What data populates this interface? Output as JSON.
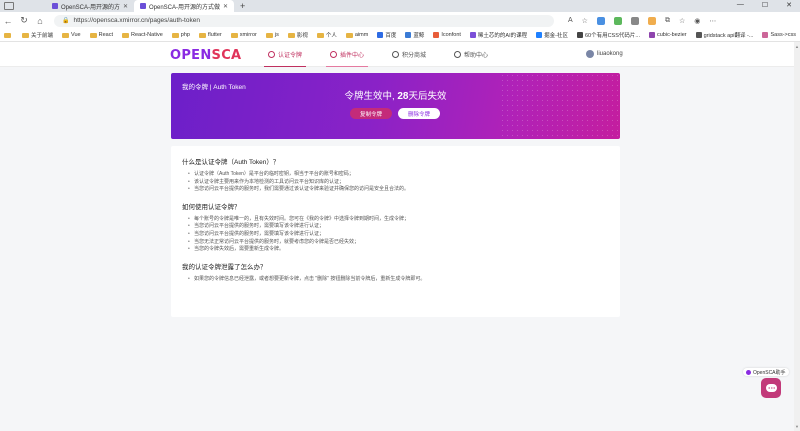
{
  "browser": {
    "tabs": [
      {
        "title": "OpenSCA-用开源的方式做开源风...",
        "active": false
      },
      {
        "title": "OpenSCA-用开源的方式做开源风...",
        "active": true
      }
    ],
    "url": "https://opensca.xmirror.cn/pages/auth-token",
    "bookmarks": [
      "",
      "关于前端",
      "Vue",
      "React",
      "React-Native",
      "php",
      "flutter",
      "xmirror",
      "js",
      "影视",
      "个人",
      "aimm",
      "百度",
      "蓝鲸",
      "Iconfont",
      "稀土芯的的AI的课程",
      "掘金-社区",
      "60个有用CSS代码片...",
      "cubic-bezier",
      "gridstack api翻译 -...",
      "Sass->css"
    ]
  },
  "site": {
    "logo_open": "OPEN",
    "logo_sca": "SCA",
    "nav": [
      {
        "label": "认证令牌",
        "state": "active"
      },
      {
        "label": "插件中心",
        "state": "hover"
      },
      {
        "label": "积分商城",
        "state": "normal"
      },
      {
        "label": "帮助中心",
        "state": "normal"
      }
    ],
    "username": "liuaokong"
  },
  "banner": {
    "label": "我的令牌 | Auth Token",
    "title_prefix": "令牌生效中, ",
    "days": "28",
    "title_suffix": "天后失效",
    "copy_label": "复制令牌",
    "delete_label": "删除令牌"
  },
  "faq": [
    {
      "question": "什么是认证令牌（Auth Token）？",
      "answers": [
        "认证令牌（Auth Token）是平台的临时密钥，相当于平台的账号和密码；",
        "该认证令牌主要用来作为本地检测的工具访问云平台知识库的认证；",
        "当您访问云平台提供的服务时，我们需要通过该认证令牌来验证并确保您的访问是安全且合法的。"
      ]
    },
    {
      "question": "如何使用认证令牌？",
      "answers": [
        "每个账号的令牌是唯一的，且有失效时间。您可在《我的令牌》中选择令牌到期时间，生成令牌；",
        "当您访问云平台提供的服务时，需要填写该令牌进行认证；",
        "当您访问云平台提供的服务时，需要填写该令牌进行认证；",
        "当您无法正常访问云平台提供的服务时，就要考虑您的令牌是否已经失效；",
        "当您的令牌失效后，需要重新生成令牌。"
      ]
    },
    {
      "question": "我的认证令牌泄露了怎么办？",
      "answers": [
        "如果您的令牌信息已经泄露，或者想要更新令牌，点击 \"删除\" 按钮删除当前令牌后，重新生成令牌即可。"
      ]
    }
  ],
  "widgets": {
    "assistant_label": "OpenSCA助手"
  },
  "colors": {
    "brand_purple": "#8a2be2",
    "brand_pink": "#c0305f",
    "banner_start": "#6c1fc9",
    "banner_end": "#c41e9f"
  }
}
